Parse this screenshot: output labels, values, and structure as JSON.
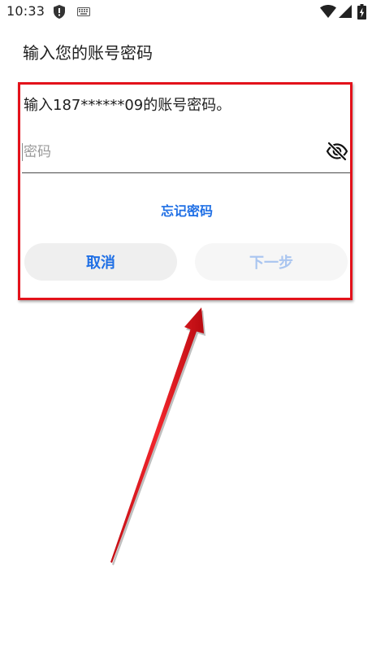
{
  "status_bar": {
    "time": "10:33",
    "icons": [
      "shield-icon",
      "keyboard-icon",
      "wifi-icon",
      "signal-icon",
      "battery-charging-icon"
    ]
  },
  "header": {
    "title": "输入您的账号密码"
  },
  "dialog": {
    "prompt": "输入187******09的账号密码。",
    "password": {
      "value": "",
      "placeholder": "密码",
      "toggle_icon": "eye-off-icon"
    },
    "forgot_password": "忘记密码",
    "cancel_label": "取消",
    "next_label": "下一步",
    "next_enabled": false
  },
  "colors": {
    "accent": "#1f6fe5",
    "disabled_text": "#a9c5f0",
    "annotation": "#e3121b"
  }
}
